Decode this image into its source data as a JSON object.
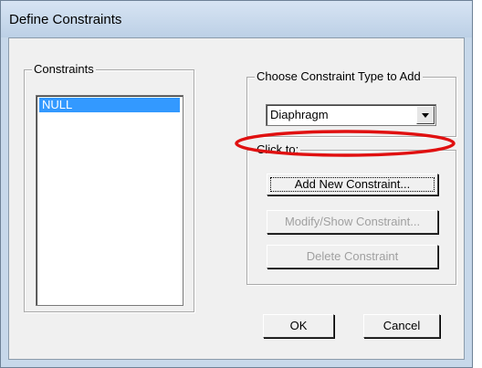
{
  "window": {
    "title": "Define Constraints"
  },
  "constraints": {
    "group_label": "Constraints",
    "items": [
      "NULL"
    ],
    "selected": "NULL"
  },
  "type_select": {
    "group_label": "Choose Constraint Type to Add",
    "value": "Diaphragm"
  },
  "actions": {
    "group_label": "Click to:",
    "add_label": "Add New Constraint...",
    "modify_label": "Modify/Show Constraint...",
    "delete_label": "Delete Constraint"
  },
  "footer": {
    "ok_label": "OK",
    "cancel_label": "Cancel"
  },
  "annotation": {
    "color": "#e01010",
    "target": "Add New Constraint..."
  },
  "colors": {
    "selection": "#3399ff",
    "dialog_bg": "#f0f0f0",
    "title_bg": "#c7d8ea"
  }
}
